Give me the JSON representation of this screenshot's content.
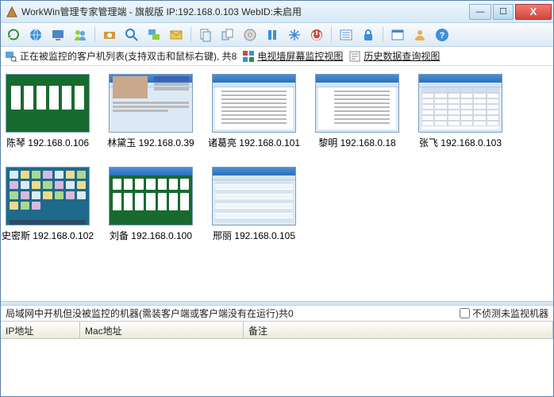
{
  "title": "WorkWin管理专家管理端 - 旗舰版 IP:192.168.0.103 WebID:未启用",
  "toolbar_icons": [
    "refresh-icon",
    "globe-icon",
    "monitor-settings-icon",
    "users-icon",
    "camera-icon",
    "search-icon",
    "remote-icon",
    "mail-icon",
    "files-icon",
    "copy-icon",
    "disc-icon",
    "pause-icon",
    "snowflake-icon",
    "power-icon",
    "list-icon",
    "lock-icon",
    "schedule-icon",
    "user-icon",
    "help-icon"
  ],
  "infobar": {
    "client_list_label": "正在被监控的客户机列表(支持双击和鼠标右键), 共8",
    "tv_wall_label": "电视墙屏幕监控视图",
    "history_label": "历史数据查询视图"
  },
  "clients": [
    {
      "name": "陈琴",
      "ip": "192.168.0.106",
      "scene": "cards-green"
    },
    {
      "name": "林黛玉",
      "ip": "192.168.0.39",
      "scene": "webpage"
    },
    {
      "name": "诸葛亮",
      "ip": "192.168.0.101",
      "scene": "word-doc"
    },
    {
      "name": "黎明",
      "ip": "192.168.0.18",
      "scene": "word-doc2"
    },
    {
      "name": "张飞",
      "ip": "192.168.0.103",
      "scene": "spreadsheet"
    },
    {
      "name": "史密斯",
      "ip": "192.168.0.102",
      "scene": "desktop-teal"
    },
    {
      "name": "刘备",
      "ip": "192.168.0.100",
      "scene": "solitaire"
    },
    {
      "name": "邢丽",
      "ip": "192.168.0.105",
      "scene": "datagrid"
    }
  ],
  "bottom": {
    "unmonitored_label": "局域网中开机但没被监控的机器(需装客户端或客户端没有在运行)共0",
    "checkbox_label": "不侦测未监视机器",
    "columns": {
      "ip": "IP地址",
      "mac": "Mac地址",
      "note": "备注"
    }
  }
}
